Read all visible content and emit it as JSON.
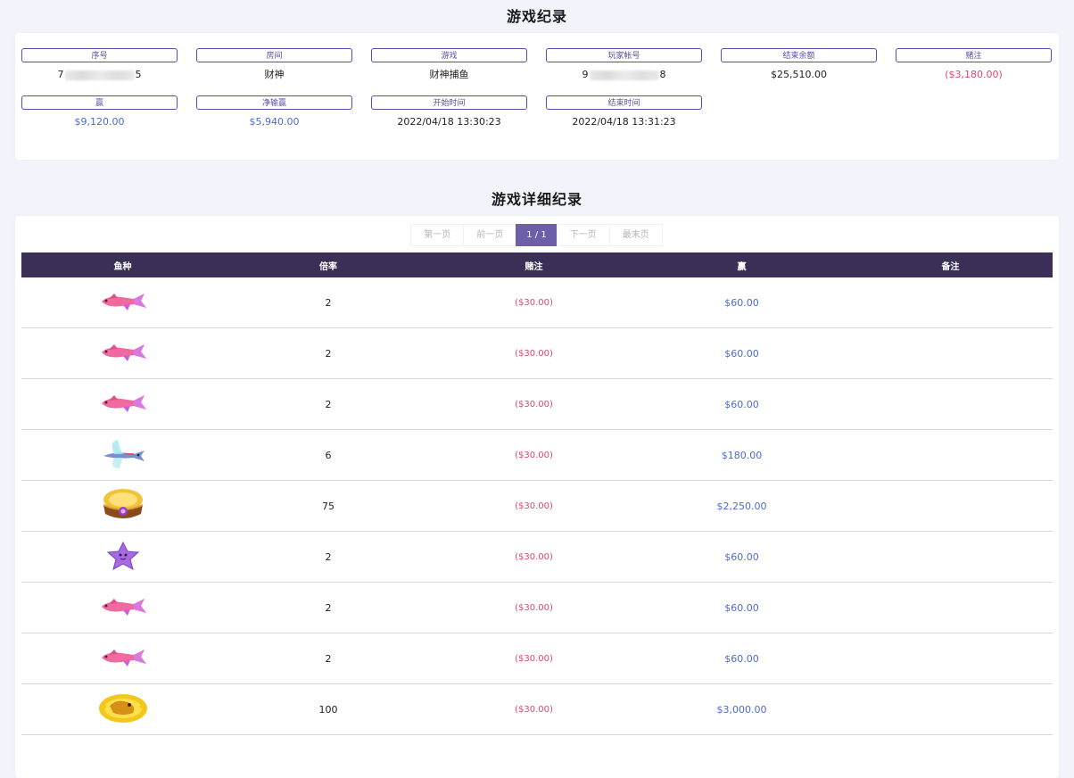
{
  "section1_title": "游戏纪录",
  "section2_title": "游戏详细纪录",
  "summary": [
    {
      "label": "序号",
      "value_prefix": "7",
      "value_suffix": "5",
      "masked": true,
      "tone": ""
    },
    {
      "label": "房间",
      "value": "财神",
      "tone": ""
    },
    {
      "label": "游戏",
      "value": "财神捕鱼",
      "tone": ""
    },
    {
      "label": "玩家帐号",
      "value_prefix": "9",
      "value_suffix": "8",
      "masked": true,
      "tone": ""
    },
    {
      "label": "结束余额",
      "value": "$25,510.00",
      "tone": ""
    },
    {
      "label": "赌注",
      "value": "($3,180.00)",
      "tone": "neg"
    },
    {
      "label": "赢",
      "value": "$9,120.00",
      "tone": "pos"
    },
    {
      "label": "净输赢",
      "value": "$5,940.00",
      "tone": "pos"
    },
    {
      "label": "开始时间",
      "value": "2022/04/18 13:30:23",
      "tone": ""
    },
    {
      "label": "结束时间",
      "value": "2022/04/18 13:31:23",
      "tone": ""
    }
  ],
  "pager": {
    "first": "第一页",
    "prev": "前一页",
    "current": "1 / 1",
    "next": "下一页",
    "last": "最末页"
  },
  "table": {
    "headers": {
      "fish": "鱼种",
      "multiplier": "倍率",
      "bet": "赌注",
      "win": "赢",
      "note": "备注"
    },
    "rows": [
      {
        "fish_icon": "pink-fish-icon",
        "multiplier": "2",
        "bet": "($30.00)",
        "win": "$60.00",
        "note": ""
      },
      {
        "fish_icon": "pink-fish-icon",
        "multiplier": "2",
        "bet": "($30.00)",
        "win": "$60.00",
        "note": ""
      },
      {
        "fish_icon": "pink-fish-icon",
        "multiplier": "2",
        "bet": "($30.00)",
        "win": "$60.00",
        "note": ""
      },
      {
        "fish_icon": "flying-fish-icon",
        "multiplier": "6",
        "bet": "($30.00)",
        "win": "$180.00",
        "note": ""
      },
      {
        "fish_icon": "treasure-bowl-icon",
        "multiplier": "75",
        "bet": "($30.00)",
        "win": "$2,250.00",
        "note": ""
      },
      {
        "fish_icon": "starfish-icon",
        "multiplier": "2",
        "bet": "($30.00)",
        "win": "$60.00",
        "note": ""
      },
      {
        "fish_icon": "pink-fish-icon",
        "multiplier": "2",
        "bet": "($30.00)",
        "win": "$60.00",
        "note": ""
      },
      {
        "fish_icon": "pink-fish-icon",
        "multiplier": "2",
        "bet": "($30.00)",
        "win": "$60.00",
        "note": ""
      },
      {
        "fish_icon": "golden-toad-icon",
        "multiplier": "100",
        "bet": "($30.00)",
        "win": "$3,000.00",
        "note": ""
      }
    ]
  },
  "colors": {
    "accent": "#5a4fa8",
    "header_bg": "#3b2f57",
    "negative": "#d64a6b",
    "positive": "#4c6bd0"
  }
}
